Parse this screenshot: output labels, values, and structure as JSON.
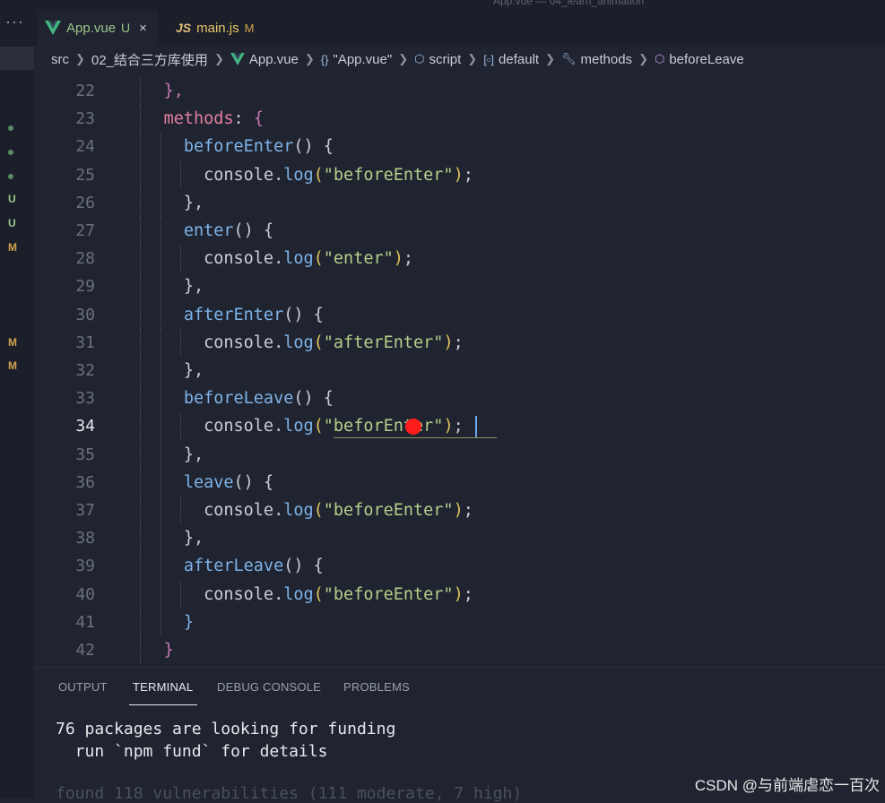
{
  "window": {
    "title": "App.vue — 04_learn_animation"
  },
  "activity": {
    "more": "···",
    "git_badges": [
      "U",
      "U",
      "M",
      "M",
      "M"
    ]
  },
  "tabs": [
    {
      "label": "App.vue",
      "status": "U",
      "close": "×",
      "icon": "vue-icon",
      "active": true
    },
    {
      "label": "main.js",
      "status": "M",
      "icon_text": "JS",
      "active": false
    }
  ],
  "breadcrumb": {
    "items": [
      "src",
      "02_结合三方库使用",
      "App.vue",
      "\"App.vue\"",
      "script",
      "default",
      "methods",
      "beforeLeave"
    ],
    "icons": [
      "",
      "",
      "vue-icon",
      "braces-icon",
      "cube-icon",
      "variable-icon",
      "wrench-icon",
      "cube-icon"
    ]
  },
  "editor": {
    "current_line": "34",
    "lines": [
      {
        "n": "22",
        "code": "  },",
        "parts": [
          {
            "t": "    ",
            "c": ""
          },
          {
            "t": "},",
            "c": "k-brace"
          }
        ]
      },
      {
        "n": "23",
        "parts": [
          {
            "t": "    ",
            "c": ""
          },
          {
            "t": "methods",
            "c": "k-prop"
          },
          {
            "t": ": ",
            "c": "k-punc"
          },
          {
            "t": "{",
            "c": "k-brace"
          }
        ]
      },
      {
        "n": "24",
        "parts": [
          {
            "t": "      ",
            "c": ""
          },
          {
            "t": "beforeEnter",
            "c": "k-name"
          },
          {
            "t": "() ",
            "c": "k-punc"
          },
          {
            "t": "{",
            "c": "k-punc"
          }
        ]
      },
      {
        "n": "25",
        "parts": [
          {
            "t": "        ",
            "c": ""
          },
          {
            "t": "console",
            "c": "k-obj"
          },
          {
            "t": ".",
            "c": "k-punc"
          },
          {
            "t": "log",
            "c": "k-call"
          },
          {
            "t": "(",
            "c": "k-paren1"
          },
          {
            "t": "\"beforeEnter\"",
            "c": "k-str"
          },
          {
            "t": ")",
            "c": "k-paren1"
          },
          {
            "t": ";",
            "c": "k-punc"
          }
        ]
      },
      {
        "n": "26",
        "parts": [
          {
            "t": "      ",
            "c": ""
          },
          {
            "t": "},",
            "c": "k-punc"
          }
        ]
      },
      {
        "n": "27",
        "parts": [
          {
            "t": "      ",
            "c": ""
          },
          {
            "t": "enter",
            "c": "k-name"
          },
          {
            "t": "() ",
            "c": "k-punc"
          },
          {
            "t": "{",
            "c": "k-punc"
          }
        ]
      },
      {
        "n": "28",
        "parts": [
          {
            "t": "        ",
            "c": ""
          },
          {
            "t": "console",
            "c": "k-obj"
          },
          {
            "t": ".",
            "c": "k-punc"
          },
          {
            "t": "log",
            "c": "k-call"
          },
          {
            "t": "(",
            "c": "k-paren1"
          },
          {
            "t": "\"enter\"",
            "c": "k-str"
          },
          {
            "t": ")",
            "c": "k-paren1"
          },
          {
            "t": ";",
            "c": "k-punc"
          }
        ]
      },
      {
        "n": "29",
        "parts": [
          {
            "t": "      ",
            "c": ""
          },
          {
            "t": "},",
            "c": "k-punc"
          }
        ]
      },
      {
        "n": "30",
        "parts": [
          {
            "t": "      ",
            "c": ""
          },
          {
            "t": "afterEnter",
            "c": "k-name"
          },
          {
            "t": "() ",
            "c": "k-punc"
          },
          {
            "t": "{",
            "c": "k-punc"
          }
        ]
      },
      {
        "n": "31",
        "parts": [
          {
            "t": "        ",
            "c": ""
          },
          {
            "t": "console",
            "c": "k-obj"
          },
          {
            "t": ".",
            "c": "k-punc"
          },
          {
            "t": "log",
            "c": "k-call"
          },
          {
            "t": "(",
            "c": "k-paren1"
          },
          {
            "t": "\"afterEnter\"",
            "c": "k-str"
          },
          {
            "t": ")",
            "c": "k-paren1"
          },
          {
            "t": ";",
            "c": "k-punc"
          }
        ]
      },
      {
        "n": "32",
        "parts": [
          {
            "t": "      ",
            "c": ""
          },
          {
            "t": "},",
            "c": "k-punc"
          }
        ]
      },
      {
        "n": "33",
        "parts": [
          {
            "t": "      ",
            "c": ""
          },
          {
            "t": "beforeLeave",
            "c": "k-name"
          },
          {
            "t": "() ",
            "c": "k-punc"
          },
          {
            "t": "{",
            "c": "k-punc"
          }
        ]
      },
      {
        "n": "34",
        "parts": [
          {
            "t": "        ",
            "c": ""
          },
          {
            "t": "console",
            "c": "k-obj"
          },
          {
            "t": ".",
            "c": "k-punc"
          },
          {
            "t": "log",
            "c": "k-call"
          },
          {
            "t": "(",
            "c": "k-paren1"
          },
          {
            "t": "\"beforEnter\"",
            "c": "k-str"
          },
          {
            "t": ")",
            "c": "k-paren1"
          },
          {
            "t": ";",
            "c": "k-punc"
          }
        ]
      },
      {
        "n": "35",
        "parts": [
          {
            "t": "      ",
            "c": ""
          },
          {
            "t": "},",
            "c": "k-punc"
          }
        ]
      },
      {
        "n": "36",
        "parts": [
          {
            "t": "      ",
            "c": ""
          },
          {
            "t": "leave",
            "c": "k-name"
          },
          {
            "t": "() ",
            "c": "k-punc"
          },
          {
            "t": "{",
            "c": "k-punc"
          }
        ]
      },
      {
        "n": "37",
        "parts": [
          {
            "t": "        ",
            "c": ""
          },
          {
            "t": "console",
            "c": "k-obj"
          },
          {
            "t": ".",
            "c": "k-punc"
          },
          {
            "t": "log",
            "c": "k-call"
          },
          {
            "t": "(",
            "c": "k-paren1"
          },
          {
            "t": "\"beforeEnter\"",
            "c": "k-str"
          },
          {
            "t": ")",
            "c": "k-paren1"
          },
          {
            "t": ";",
            "c": "k-punc"
          }
        ]
      },
      {
        "n": "38",
        "parts": [
          {
            "t": "      ",
            "c": ""
          },
          {
            "t": "},",
            "c": "k-punc"
          }
        ]
      },
      {
        "n": "39",
        "parts": [
          {
            "t": "      ",
            "c": ""
          },
          {
            "t": "afterLeave",
            "c": "k-name"
          },
          {
            "t": "() ",
            "c": "k-punc"
          },
          {
            "t": "{",
            "c": "k-punc"
          }
        ]
      },
      {
        "n": "40",
        "parts": [
          {
            "t": "        ",
            "c": ""
          },
          {
            "t": "console",
            "c": "k-obj"
          },
          {
            "t": ".",
            "c": "k-punc"
          },
          {
            "t": "log",
            "c": "k-call"
          },
          {
            "t": "(",
            "c": "k-paren1"
          },
          {
            "t": "\"beforeEnter\"",
            "c": "k-str"
          },
          {
            "t": ")",
            "c": "k-paren1"
          },
          {
            "t": ";",
            "c": "k-punc"
          }
        ]
      },
      {
        "n": "41",
        "parts": [
          {
            "t": "      ",
            "c": ""
          },
          {
            "t": "}",
            "c": "k-brace2"
          }
        ]
      },
      {
        "n": "42",
        "parts": [
          {
            "t": "    ",
            "c": ""
          },
          {
            "t": "}",
            "c": "k-brace"
          }
        ]
      }
    ]
  },
  "panel": {
    "tabs": [
      "OUTPUT",
      "TERMINAL",
      "DEBUG CONSOLE",
      "PROBLEMS"
    ],
    "active_tab": "TERMINAL",
    "terminal_lines": [
      "76 packages are looking for funding",
      "  run `npm fund` for details"
    ],
    "partial_line": "found 118 vulnerabilities (111 moderate, 7 high)"
  },
  "watermark": "CSDN @与前端虐恋一百次",
  "colors": {
    "background": "#1f2430",
    "string": "#b4cf8a",
    "function": "#7fb3e8",
    "keyword": "#e47fa0",
    "cursor_marker": "#ff1e1e"
  }
}
